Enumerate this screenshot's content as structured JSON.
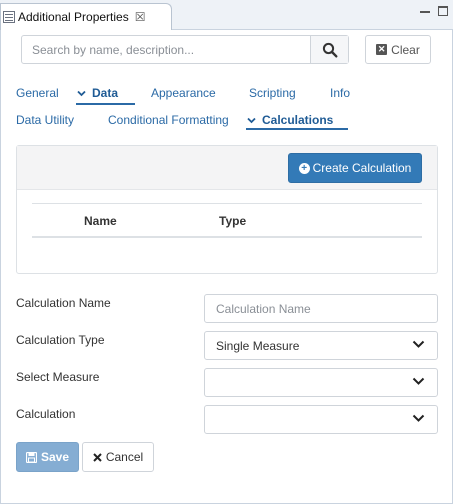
{
  "view": {
    "title": "Additional Properties",
    "close_glyph": "☒"
  },
  "search": {
    "placeholder": "Search by name, description...",
    "clear_label": "Clear"
  },
  "tabs_primary": [
    {
      "label": "General",
      "active": false
    },
    {
      "label": "Data",
      "active": true
    },
    {
      "label": "Appearance",
      "active": false
    },
    {
      "label": "Scripting",
      "active": false
    },
    {
      "label": "Info",
      "active": false
    }
  ],
  "tabs_secondary": [
    {
      "label": "Data Utility",
      "active": false
    },
    {
      "label": "Conditional Formatting",
      "active": false
    },
    {
      "label": "Calculations",
      "active": true
    }
  ],
  "calc_panel": {
    "create_label": "Create Calculation",
    "columns": [
      "Name",
      "Type"
    ],
    "rows": []
  },
  "form": {
    "name_label": "Calculation Name",
    "name_placeholder": "Calculation Name",
    "type_label": "Calculation Type",
    "type_value": "Single Measure",
    "measure_label": "Select Measure",
    "measure_value": "",
    "calc_label": "Calculation",
    "calc_value": ""
  },
  "actions": {
    "save_label": "Save",
    "cancel_label": "Cancel"
  },
  "colors": {
    "accent": "#337ab7",
    "tab_text": "#2b6aa6",
    "save_disabled": "#85add3"
  },
  "icons": {
    "view": "properties-view-icon",
    "search": "search-icon",
    "clear": "clear-x-icon",
    "create": "plus-circle-icon",
    "dropdown": "chevron-down-icon",
    "save": "floppy-disk-icon",
    "cancel": "close-icon"
  }
}
